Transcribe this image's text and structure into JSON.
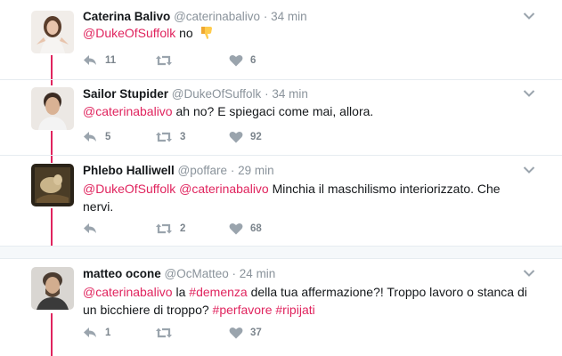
{
  "tweets": [
    {
      "name": "Caterina Balivo",
      "handle": "@caterinabalivo",
      "sep": "·",
      "time": "34 min",
      "parts": [
        {
          "t": "@DukeOfSuffolk",
          "k": "mention"
        },
        {
          "t": " no ",
          "k": "text"
        }
      ],
      "emoji": "thumbs-down",
      "reply_count": "11",
      "retweet_count": "",
      "like_count": "6",
      "avatar": "woman-avatar"
    },
    {
      "name": "Sailor Stupider",
      "handle": "@DukeOfSuffolk",
      "sep": "·",
      "time": "34 min",
      "parts": [
        {
          "t": "@caterinabalivo",
          "k": "mention"
        },
        {
          "t": " ah no? E spiegaci come mai, allora.",
          "k": "text"
        }
      ],
      "reply_count": "5",
      "retweet_count": "3",
      "like_count": "92",
      "avatar": "man-avatar"
    },
    {
      "name": "Phlebo Halliwell",
      "handle": "@poffare",
      "sep": "·",
      "time": "29 min",
      "parts": [
        {
          "t": "@DukeOfSuffolk",
          "k": "mention"
        },
        {
          "t": " ",
          "k": "text"
        },
        {
          "t": "@caterinabalivo",
          "k": "mention"
        },
        {
          "t": " Minchia il maschilismo interiorizzato. Che nervi.",
          "k": "text"
        }
      ],
      "reply_count": "",
      "retweet_count": "2",
      "like_count": "68",
      "avatar": "painting-avatar"
    },
    {
      "name": "matteo ocone",
      "handle": "@OcMatteo",
      "sep": "·",
      "time": "24 min",
      "parts": [
        {
          "t": "@caterinabalivo",
          "k": "mention"
        },
        {
          "t": " la ",
          "k": "text"
        },
        {
          "t": "#demenza",
          "k": "hashtag"
        },
        {
          "t": " della tua affermazione?! Troppo lavoro o stanca di un bicchiere di troppo? ",
          "k": "text"
        },
        {
          "t": "#perfavore",
          "k": "hashtag"
        },
        {
          "t": " ",
          "k": "text"
        },
        {
          "t": "#ripijati",
          "k": "hashtag"
        }
      ],
      "reply_count": "1",
      "retweet_count": "",
      "like_count": "37",
      "avatar": "bearded-man-avatar"
    }
  ],
  "colors": {
    "accent": "#e0245e",
    "muted": "#8a939b",
    "divider": "#e6ecf0"
  },
  "icons": [
    "reply-icon",
    "retweet-icon",
    "like-icon",
    "chevron-down-icon",
    "thumbs-down-emoji"
  ]
}
